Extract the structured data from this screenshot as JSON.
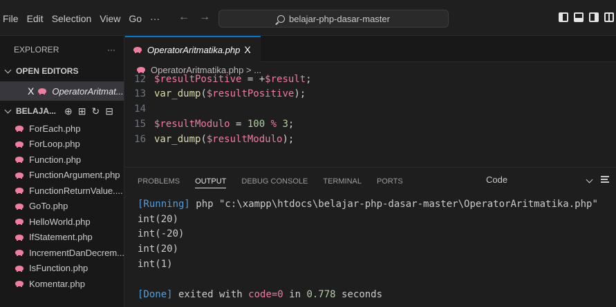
{
  "menu": [
    "File",
    "Edit",
    "Selection",
    "View",
    "Go",
    "···"
  ],
  "nav": {
    "back": "←",
    "forward": "→"
  },
  "search": {
    "text": "belajar-php-dasar-master"
  },
  "sidebar": {
    "title": "EXPLORER",
    "title_more": "···",
    "open_editors_label": "OPEN EDITORS",
    "open_editor_close": "X",
    "open_editor_name": "OperatorAritmat...",
    "folder_label": "BELAJA...",
    "folder_actions": [
      "⊕",
      "⊞",
      "↻",
      "⊟"
    ],
    "files": [
      "ForEach.php",
      "ForLoop.php",
      "Function.php",
      "FunctionArgument.php",
      "FunctionReturnValue....",
      "GoTo.php",
      "HelloWorld.php",
      "IfStatement.php",
      "IncrementDanDecrem...",
      "IsFunction.php",
      "Komentar.php"
    ]
  },
  "editor": {
    "tab_label": "OperatorAritmatika.php",
    "tab_close": "X",
    "breadcrumb": "OperatorAritmatika.php > ...",
    "lines": [
      {
        "num": "12",
        "text": "$resultPositive = +$result;"
      },
      {
        "num": "13",
        "text": "var_dump($resultPositive);"
      },
      {
        "num": "14",
        "text": ""
      },
      {
        "num": "15",
        "text": "$resultModulo = 100 % 3;"
      },
      {
        "num": "16",
        "text": "var_dump($resultModulo);"
      }
    ]
  },
  "panel": {
    "tabs": [
      "PROBLEMS",
      "OUTPUT",
      "DEBUG CONSOLE",
      "TERMINAL",
      "PORTS"
    ],
    "active_tab": "OUTPUT",
    "channel": "Code",
    "running_tag": "[Running]",
    "running_cmd": " php \"c:\\xampp\\htdocs\\belajar-php-dasar-master\\OperatorAritmatika.php\"",
    "output": [
      "int(20)",
      "int(-20)",
      "int(20)",
      "int(1)"
    ],
    "done_tag": "[Done]",
    "done_text_1": " exited with ",
    "done_code": "code=0",
    "done_text_2": " in ",
    "done_time": "0.778",
    "done_text_3": " seconds"
  }
}
